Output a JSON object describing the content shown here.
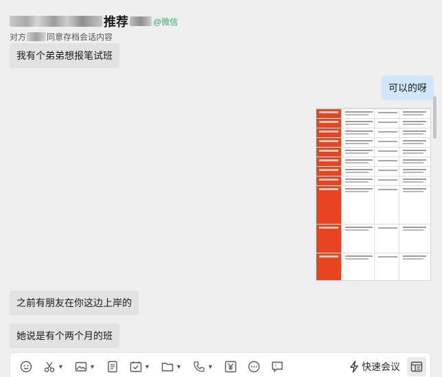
{
  "header": {
    "contact_name": "推荐",
    "contact_tag": "@微信",
    "subtitle_start": "对方",
    "subtitle_end": "同意存档会话内容"
  },
  "messages": [
    {
      "side": "left",
      "text": "我有个弟弟想报笔试班"
    },
    {
      "side": "right",
      "text": "可以的呀"
    },
    {
      "side": "right",
      "type": "image",
      "description": "course schedule table"
    },
    {
      "side": "left",
      "text": "之前有朋友在你这边上岸的"
    },
    {
      "side": "left",
      "text": "她说是有个两个月的班"
    }
  ],
  "toolbar": {
    "items": [
      "emoji-icon",
      "scissors-icon",
      "image-icon",
      "document-icon",
      "calendar-check-icon",
      "folder-icon",
      "phone-icon",
      "yen-icon",
      "more-icon",
      "chat-icon"
    ],
    "quick_meeting_label": "快速会议"
  },
  "colors": {
    "accent_green": "#2aae67",
    "bubble_right": "#cfe6fb",
    "bubble_left": "#e2e2e2",
    "schedule_red": "#e8441f"
  }
}
